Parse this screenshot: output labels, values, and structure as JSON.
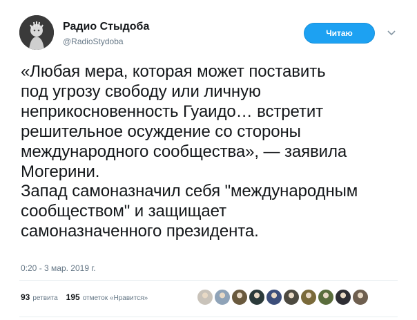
{
  "header": {
    "display_name": "Радио Стыдоба",
    "handle": "@RadioStydoba",
    "follow_label": "Читаю"
  },
  "tweet": {
    "lines": [
      "«Любая мера, которая может поставить",
      "под угрозу свободу или личную",
      "неприкосновенность Гуаидо… встретит",
      "решительное осуждение со стороны",
      "международного сообщества», — заявила",
      "Могерини.",
      "Запад самоназначил себя \"международным",
      "сообществом\" и защищает",
      "самоназначенного президента."
    ],
    "timestamp": "0:20 - 3 мар. 2019 г."
  },
  "stats": {
    "retweets_count": "93",
    "retweets_label": "ретвита",
    "likes_count": "195",
    "likes_label": "отметок «Нравится»"
  },
  "liker_avatars": [
    {
      "name": "liker-avatar-1",
      "color": "#c9c3ba"
    },
    {
      "name": "liker-avatar-2",
      "color": "#8fa3b8"
    },
    {
      "name": "liker-avatar-3",
      "color": "#6a5a3e"
    },
    {
      "name": "liker-avatar-4",
      "color": "#2b3a3a"
    },
    {
      "name": "liker-avatar-5",
      "color": "#3c4e7a"
    },
    {
      "name": "liker-avatar-6",
      "color": "#4d4a40"
    },
    {
      "name": "liker-avatar-7",
      "color": "#7a6a3a"
    },
    {
      "name": "liker-avatar-8",
      "color": "#5a6d3c"
    },
    {
      "name": "liker-avatar-9",
      "color": "#2e2e34"
    },
    {
      "name": "liker-avatar-10",
      "color": "#6e5f4f"
    }
  ],
  "colors": {
    "accent": "#1da1f2",
    "text": "#14171a",
    "muted": "#657786"
  }
}
